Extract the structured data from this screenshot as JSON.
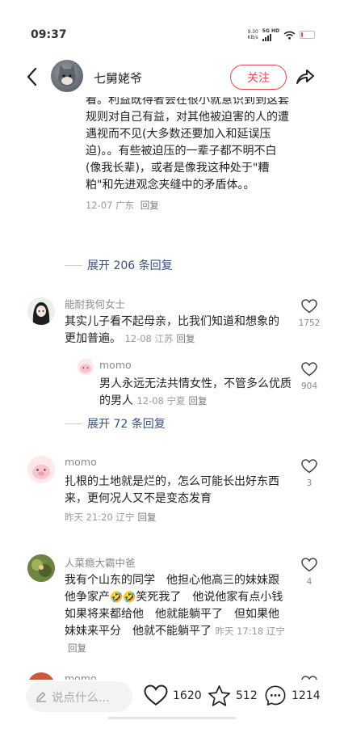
{
  "status": {
    "time": "09:37",
    "net_speed_value": "9.30",
    "net_speed_unit": "KB/s",
    "net_type": "5G HD",
    "battery_level": 0.15,
    "battery_color": "#e05050"
  },
  "header": {
    "author_name": "七舅姥爷",
    "follow_label": "关注",
    "accent_color": "#e24a55"
  },
  "thread": {
    "continued_text": "看。利益既得者会在很小就意识到到这套规则对自己有益，对其他被迫害的人的遭遇视而不见(大多数还要加入和延误压迫)。。有些被迫压的一辈子都不明不白(像我长辈)，或者是像我这种处于\"糟粕\"和先进观念夹缝中的矛盾体。。",
    "continued_meta": "12-07 广东",
    "reply_label": "回复",
    "expand_label": "展开 206 条回复"
  },
  "comments": [
    {
      "name": "能耐我何女士",
      "text": "其实儿子看不起母亲，比我们知道和想象的更加普遍。",
      "meta": "12-08 江苏",
      "likes": "1752",
      "sub_reply": {
        "name": "momo",
        "text": "男人永远无法共情女性，不管多么优质的男人",
        "meta": "12-08 宁夏",
        "likes": "904"
      },
      "expand_label": "展开 72 条回复"
    },
    {
      "name": "momo",
      "text": "扎根的土地就是烂的，怎么可能长出好东西来，更何况人又不是变态发育",
      "meta": "昨天 21:20 辽宁",
      "likes": "3"
    },
    {
      "name": "人菜瘾大霸中爸",
      "text_part1": "我有个山东的同学　他担心他高三的妹妹跟他争家产",
      "emoji": "🤣🤣",
      "text_part2": "笑死我了　他说他家有点小钱　如果将来都给他　他就能躺平了　但如果他妹妹来平分　他就不能躺平了",
      "meta": "昨天 17:18 辽宁",
      "likes": "4"
    },
    {
      "name": "momo"
    }
  ],
  "bottom": {
    "input_placeholder": "说点什么...",
    "likes": "1620",
    "favorites": "512",
    "comments": "1214"
  }
}
